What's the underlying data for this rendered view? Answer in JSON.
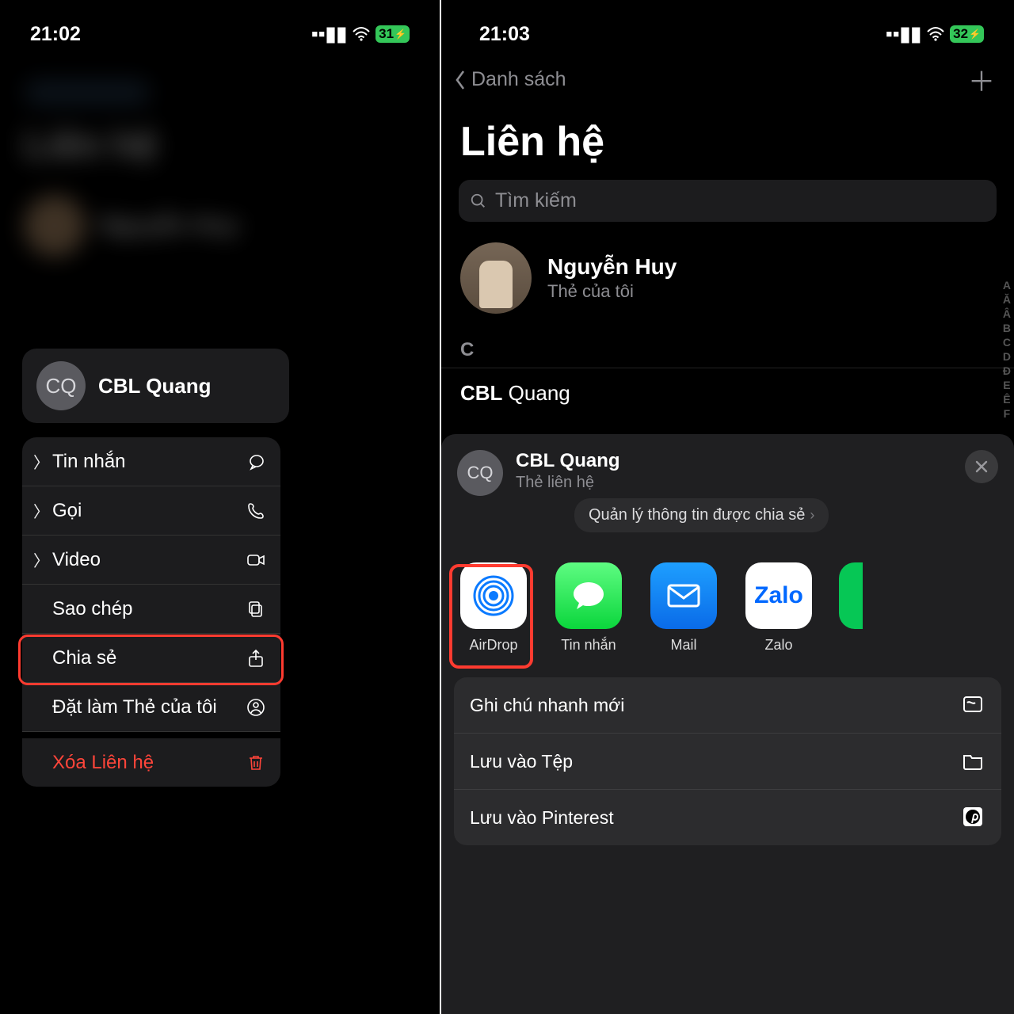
{
  "left": {
    "status_time": "21:02",
    "battery": "31",
    "contact_card": {
      "initials": "CQ",
      "name": "CBL Quang"
    },
    "menu": {
      "message": "Tin nhắn",
      "call": "Gọi",
      "video": "Video",
      "copy": "Sao chép",
      "share": "Chia sẻ",
      "set_my_card": "Đặt làm Thẻ của tôi",
      "delete": "Xóa Liên hệ"
    }
  },
  "right": {
    "status_time": "21:03",
    "battery": "32",
    "back_label": "Danh sách",
    "title": "Liên hệ",
    "search_placeholder": "Tìm kiếm",
    "me": {
      "name": "Nguyễn Huy",
      "sub": "Thẻ của tôi"
    },
    "section": "C",
    "contact_first": "CBL",
    "contact_last": "Quang",
    "index": [
      "A",
      "Ă",
      "Â",
      "B",
      "C",
      "D",
      "Đ",
      "E",
      "Ê",
      "F"
    ],
    "sheet": {
      "initials": "CQ",
      "title": "CBL Quang",
      "sub": "Thẻ liên hệ",
      "manage": "Quản lý thông tin được chia sẻ",
      "apps": {
        "airdrop": "AirDrop",
        "messages": "Tin nhắn",
        "mail": "Mail",
        "zalo": "Zalo"
      },
      "actions": {
        "quick_note": "Ghi chú nhanh mới",
        "save_files": "Lưu vào Tệp",
        "save_pinterest": "Lưu vào Pinterest"
      }
    }
  }
}
